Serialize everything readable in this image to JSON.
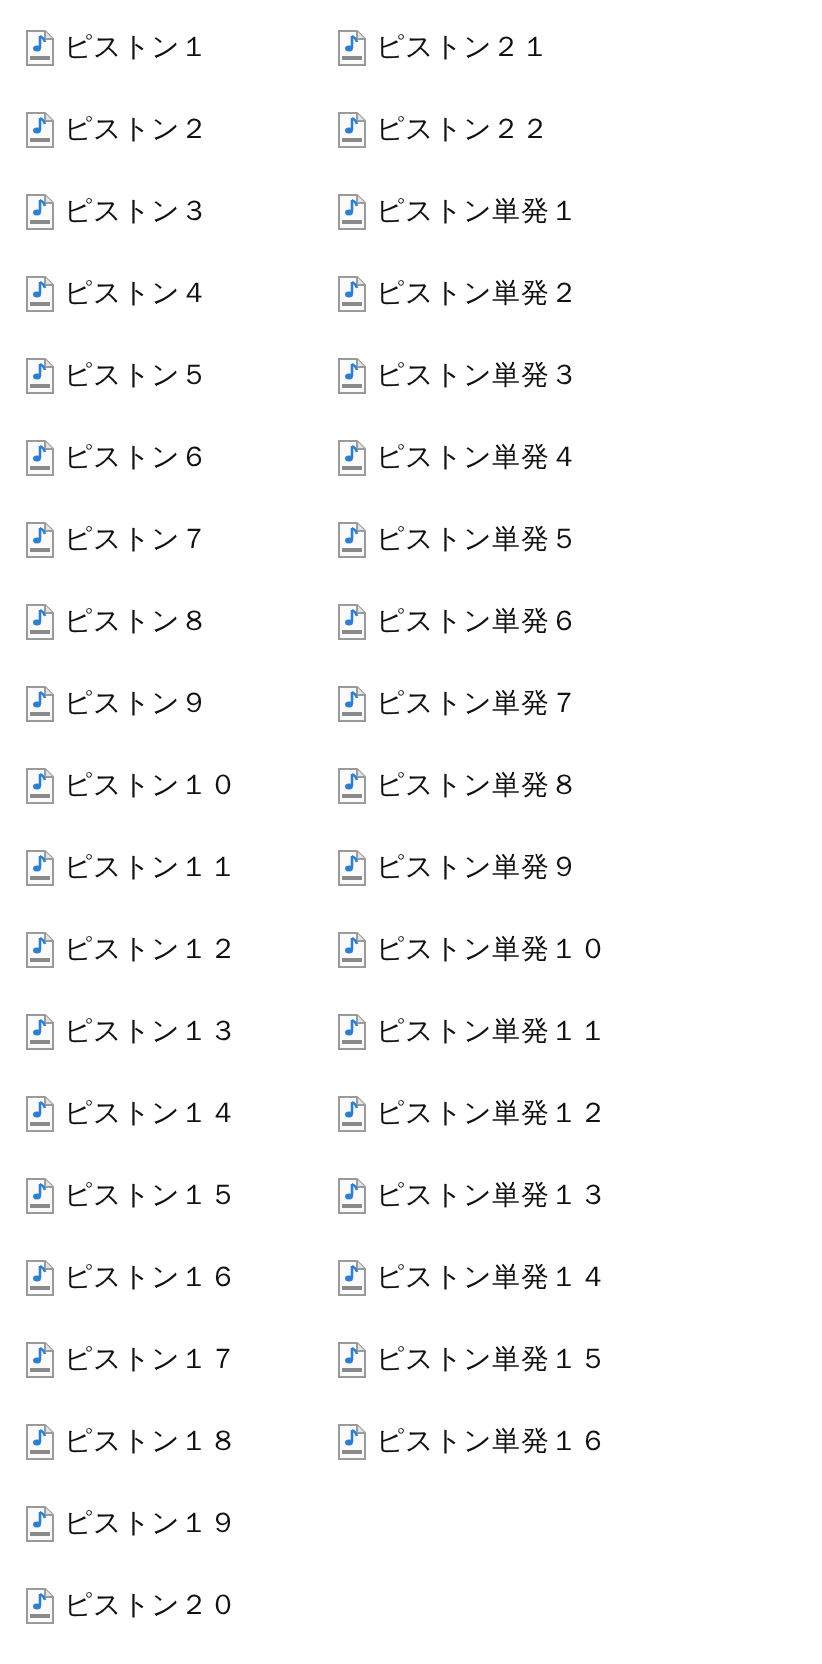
{
  "files": [
    {
      "name": "ピストン１"
    },
    {
      "name": "ピストン２"
    },
    {
      "name": "ピストン３"
    },
    {
      "name": "ピストン４"
    },
    {
      "name": "ピストン５"
    },
    {
      "name": "ピストン６"
    },
    {
      "name": "ピストン７"
    },
    {
      "name": "ピストン８"
    },
    {
      "name": "ピストン９"
    },
    {
      "name": "ピストン１０"
    },
    {
      "name": "ピストン１１"
    },
    {
      "name": "ピストン１２"
    },
    {
      "name": "ピストン１３"
    },
    {
      "name": "ピストン１４"
    },
    {
      "name": "ピストン１５"
    },
    {
      "name": "ピストン１６"
    },
    {
      "name": "ピストン１７"
    },
    {
      "name": "ピストン１８"
    },
    {
      "name": "ピストン１９"
    },
    {
      "name": "ピストン２０"
    },
    {
      "name": "ピストン２１"
    },
    {
      "name": "ピストン２２"
    },
    {
      "name": "ピストン単発１"
    },
    {
      "name": "ピストン単発２"
    },
    {
      "name": "ピストン単発３"
    },
    {
      "name": "ピストン単発４"
    },
    {
      "name": "ピストン単発５"
    },
    {
      "name": "ピストン単発６"
    },
    {
      "name": "ピストン単発７"
    },
    {
      "name": "ピストン単発８"
    },
    {
      "name": "ピストン単発９"
    },
    {
      "name": "ピストン単発１０"
    },
    {
      "name": "ピストン単発１１"
    },
    {
      "name": "ピストン単発１２"
    },
    {
      "name": "ピストン単発１３"
    },
    {
      "name": "ピストン単発１４"
    },
    {
      "name": "ピストン単発１５"
    },
    {
      "name": "ピストン単発１６"
    }
  ]
}
